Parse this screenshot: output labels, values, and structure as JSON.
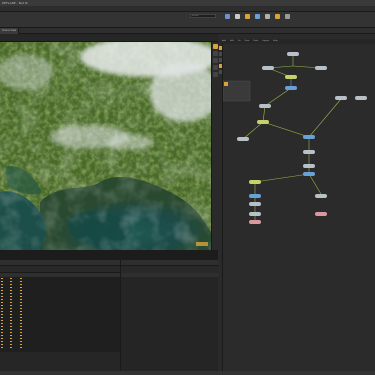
{
  "window": {
    "title": "DEFLARE - Not M"
  },
  "toolbar": {
    "search_placeholder": "Search",
    "shelf": [
      {
        "name": "shelf-tool-1",
        "label": "Tool",
        "color": "#6f8fd0"
      },
      {
        "name": "shelf-tool-2",
        "label": "Tool",
        "color": "#c9c9c9"
      },
      {
        "name": "shelf-tool-3",
        "label": "Tool",
        "color": "#d8a43a"
      },
      {
        "name": "shelf-tool-4",
        "label": "Tool",
        "color": "#6aa0d8"
      },
      {
        "name": "shelf-tool-5",
        "label": "Tool",
        "color": "#b0b0b0"
      },
      {
        "name": "shelf-tool-6",
        "label": "Tool",
        "color": "#d8a43a"
      },
      {
        "name": "shelf-tool-7",
        "label": "Tool",
        "color": "#9a9a9a"
      }
    ]
  },
  "viewport": {
    "tabs": [
      "Scene View",
      "Render View",
      "Composite"
    ],
    "active_tab": "Scene View"
  },
  "network": {
    "tabs": [
      "obj",
      "Network"
    ],
    "menu": [
      "Add",
      "Edit",
      "Go",
      "View",
      "Tools",
      "Layout",
      "Help"
    ],
    "accent": "#d8a43a"
  },
  "lower_left": {
    "tabs": [
      "Take List",
      "Tree"
    ],
    "columns": [
      "Name",
      "Value"
    ]
  },
  "lower_right": {
    "tabs": [
      "Parms",
      "Channels"
    ],
    "columns": [
      "Name",
      "Value",
      "Frame",
      "Type"
    ]
  },
  "colors": {
    "accent": "#d8a43a",
    "wire": "#9ab84a",
    "wire_blue": "#6aa0d8",
    "node": "#b8c0c8",
    "node_pink": "#d89aa0"
  }
}
